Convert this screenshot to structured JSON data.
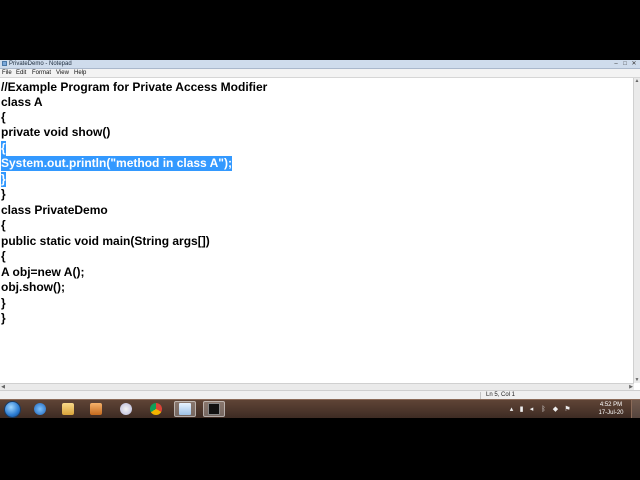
{
  "window": {
    "title": "PrivateDemo - Notepad",
    "buttons": {
      "minimize": "–",
      "maximize": "□",
      "close": "✕"
    }
  },
  "menu": {
    "items": [
      {
        "label": "File"
      },
      {
        "label": "Edit"
      },
      {
        "label": "Format"
      },
      {
        "label": "View"
      },
      {
        "label": "Help"
      }
    ]
  },
  "editor": {
    "lines": [
      {
        "text": "//Example Program for Private Access Modifier",
        "selected": false
      },
      {
        "text": "class A",
        "selected": false
      },
      {
        "text": "{",
        "selected": false
      },
      {
        "text": "private void show()",
        "selected": false
      },
      {
        "text": "{",
        "selected": true
      },
      {
        "text": "System.out.println(\"method in class A\");",
        "selected": true
      },
      {
        "text": "}",
        "selected": true
      },
      {
        "text": "}",
        "selected": false
      },
      {
        "text": "class PrivateDemo",
        "selected": false
      },
      {
        "text": "{",
        "selected": false
      },
      {
        "text": "public static void main(String args[])",
        "selected": false
      },
      {
        "text": "{",
        "selected": false
      },
      {
        "text": "A obj=new A();",
        "selected": false
      },
      {
        "text": "obj.show();",
        "selected": false
      },
      {
        "text": "}",
        "selected": false
      },
      {
        "text": "}",
        "selected": false
      }
    ],
    "selection_color": "#3399ff"
  },
  "status": {
    "position": "Ln 5, Col 1"
  },
  "taskbar": {
    "apps": [
      {
        "icon": "start-orb-icon"
      },
      {
        "icon": "internet-explorer-icon"
      },
      {
        "icon": "file-explorer-icon"
      },
      {
        "icon": "media-player-icon"
      },
      {
        "icon": "itunes-icon"
      },
      {
        "icon": "chrome-icon"
      },
      {
        "icon": "notepad-icon",
        "active": true
      },
      {
        "icon": "command-prompt-icon",
        "active": true
      }
    ],
    "tray": {
      "icons": [
        "tray-arrow-icon",
        "tray-network-icon",
        "tray-volume-icon",
        "tray-bluetooth-icon",
        "tray-shield-icon",
        "tray-flag-icon"
      ],
      "time": "4:52 PM",
      "date": "17-Jul-20"
    }
  }
}
